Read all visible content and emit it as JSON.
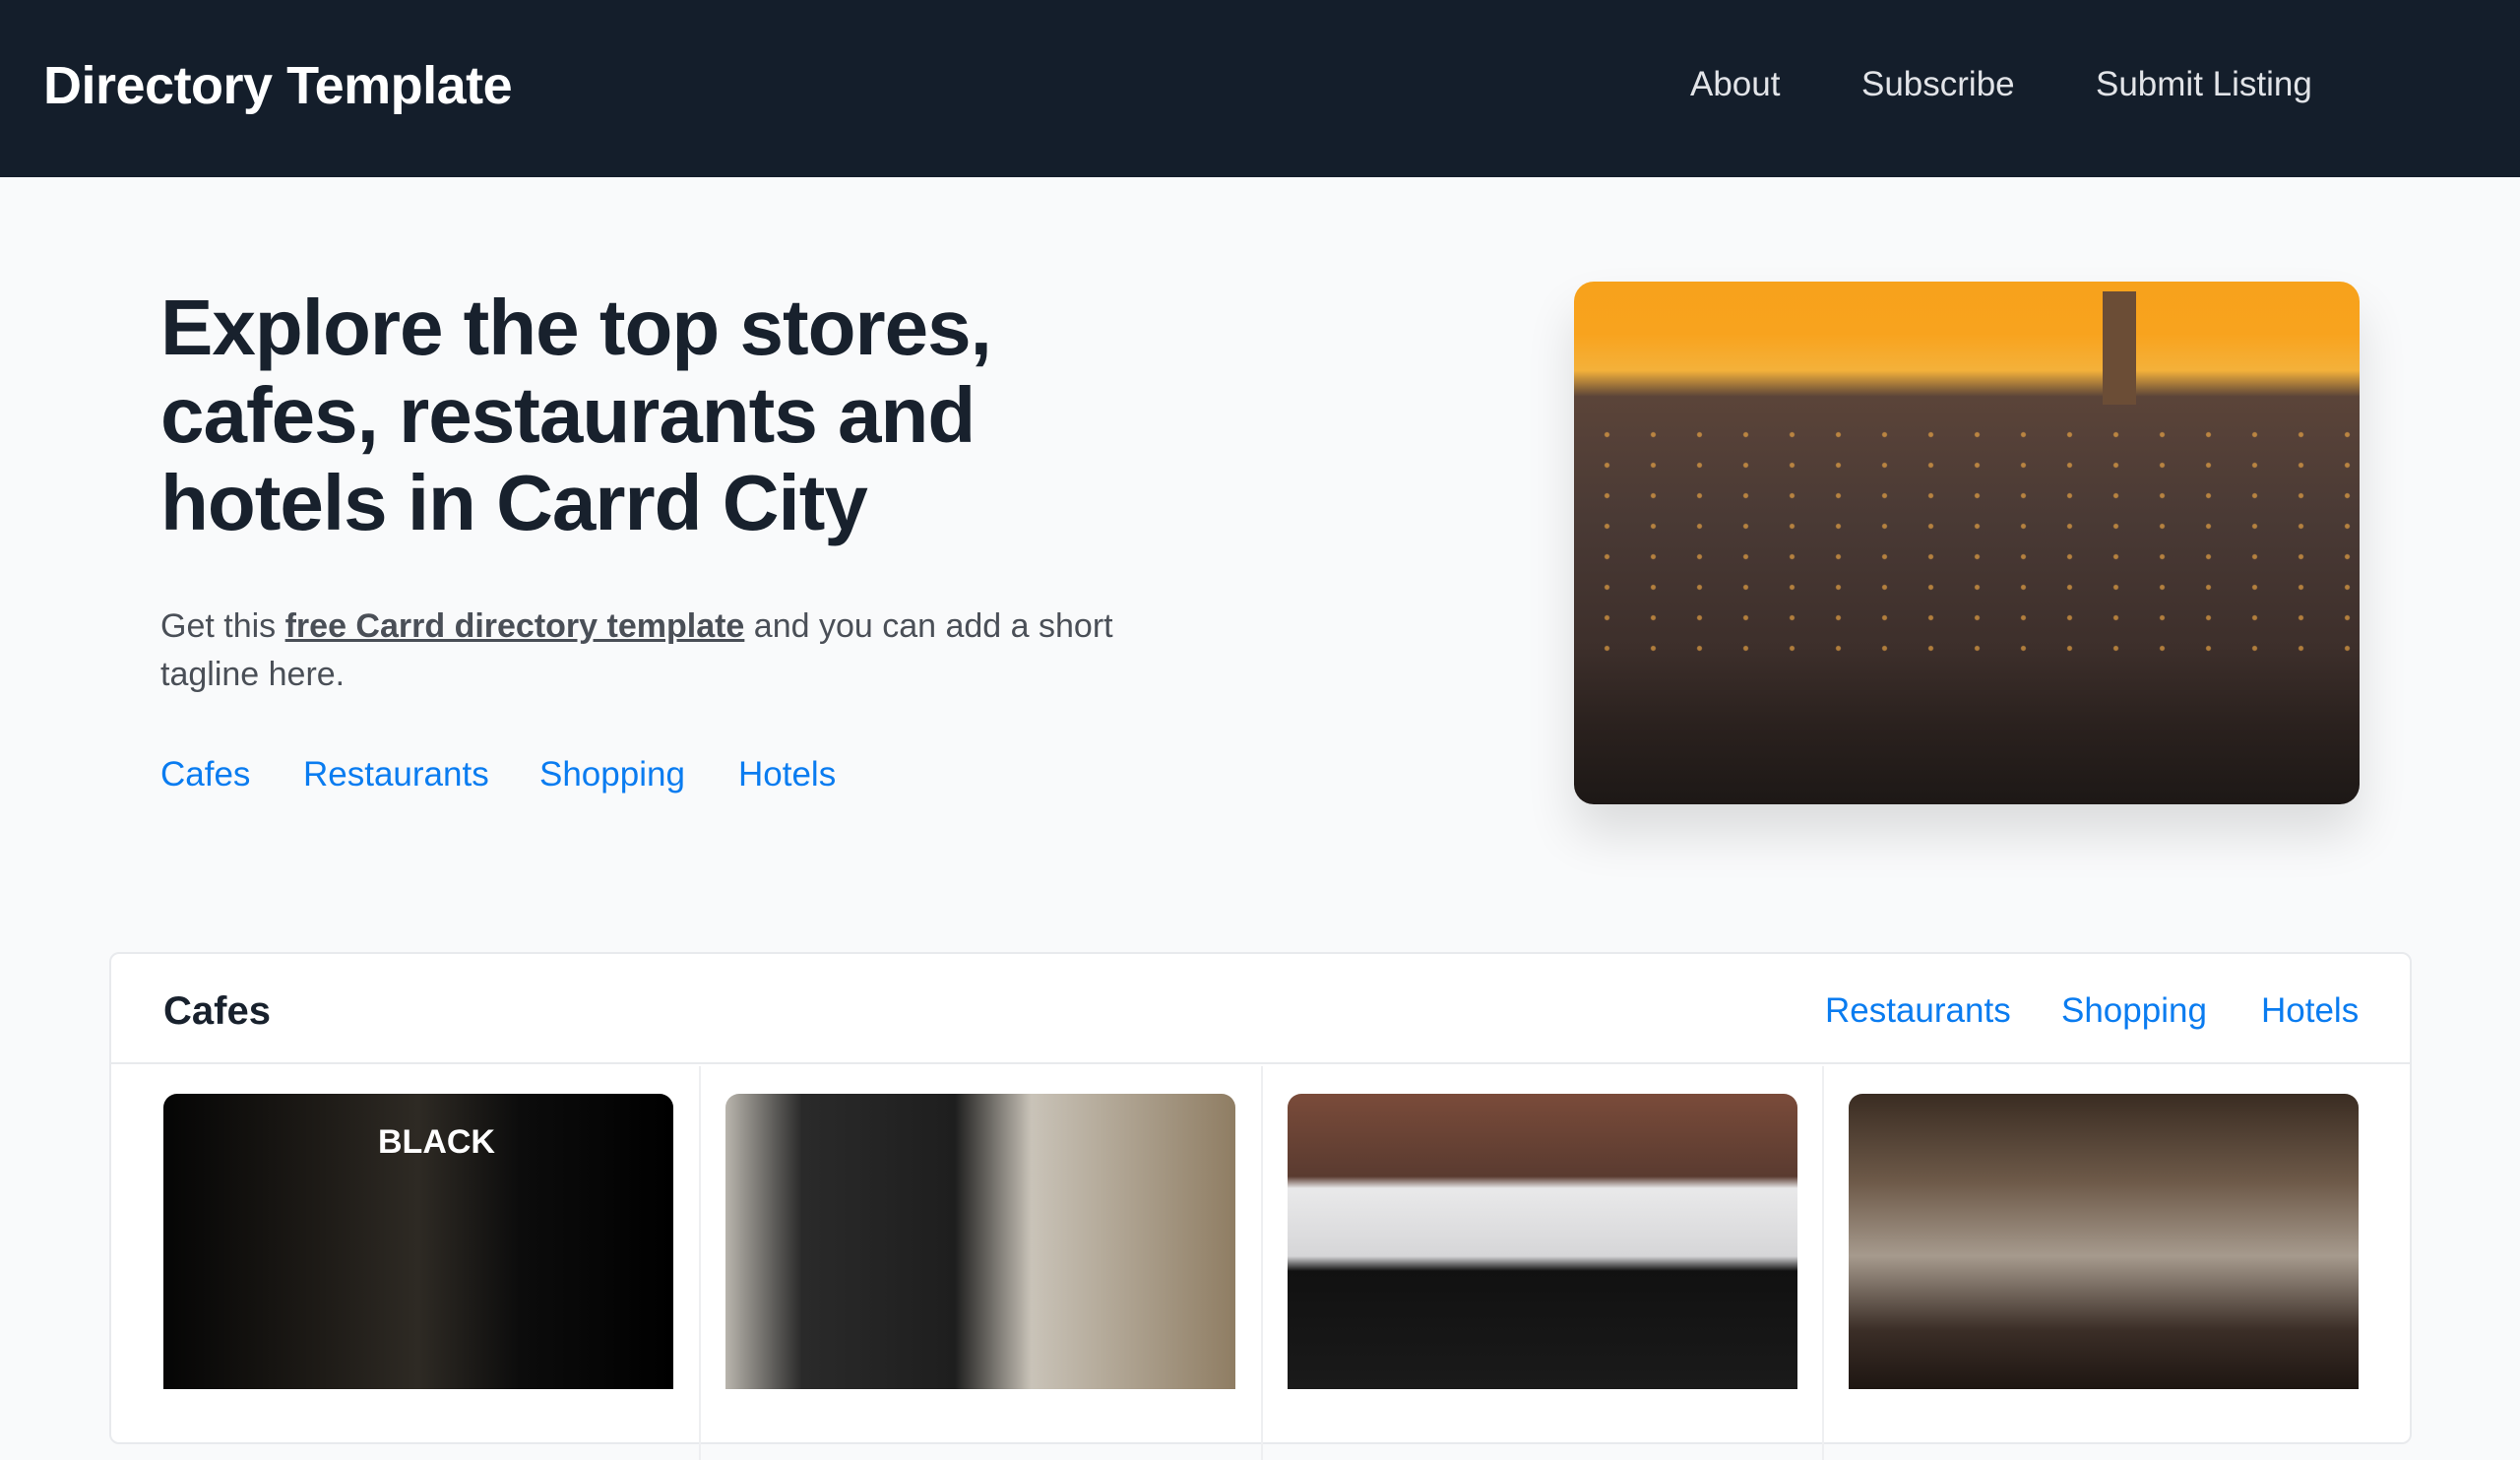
{
  "header": {
    "brand": "Directory Template",
    "nav": [
      "About",
      "Subscribe",
      "Submit Listing"
    ]
  },
  "hero": {
    "title": "Explore the top stores, cafes, restaurants and hotels in Carrd City",
    "tagline_prefix": "Get this ",
    "tagline_link": "free Carrd directory template",
    "tagline_suffix": " and you can add a short tagline here.",
    "links": [
      "Cafes",
      "Restaurants",
      "Shopping",
      "Hotels"
    ],
    "image": "city-at-sunset-photo"
  },
  "section": {
    "title": "Cafes",
    "links": [
      "Restaurants",
      "Shopping",
      "Hotels"
    ],
    "thumbnails": [
      "black-cafe-photo",
      "cafe-interior-bicycles-photo",
      "think-coffee-storefront-photo",
      "busy-cafe-interior-photo"
    ]
  },
  "colors": {
    "header_bg": "#141e2b",
    "link": "#0a7cf0",
    "text": "#18212d"
  }
}
